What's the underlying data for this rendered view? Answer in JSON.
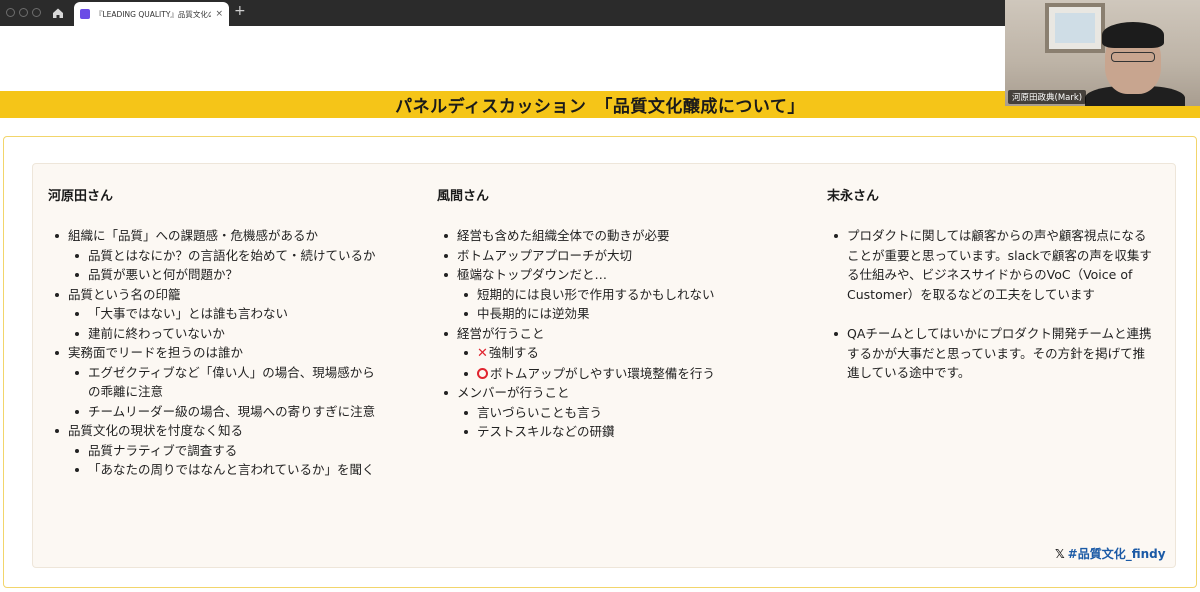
{
  "browser": {
    "tab_title": "『LEADING QUALITY』品質文化の醸",
    "tab_close": "×",
    "new_tab": "+"
  },
  "slide": {
    "title": "パネルディスカッション　「品質文化醸成について」",
    "hashtag": "#品質文化_findy",
    "columns": [
      {
        "name": "河原田さん",
        "items": [
          {
            "text": "組織に「品質」への課題感・危機感があるか",
            "sub": [
              "品質とはなにか？の言語化を始めて・続けているか",
              "品質が悪いと何が問題か？"
            ]
          },
          {
            "text": "品質という名の印籠",
            "sub": [
              "「大事ではない」とは誰も言わない",
              "建前に終わっていないか"
            ]
          },
          {
            "text": "実務面でリードを担うのは誰か",
            "sub": [
              "エグゼクティブなど「偉い人」の場合、現場感からの乖離に注意",
              "チームリーダー級の場合、現場への寄りすぎに注意"
            ]
          },
          {
            "text": "品質文化の現状を忖度なく知る",
            "sub": [
              "品質ナラティブで調査する",
              "「あなたの周りではなんと言われているか」を聞く"
            ]
          }
        ]
      },
      {
        "name": "風間さん",
        "items": [
          {
            "text": "経営も含めた組織全体での動きが必要",
            "sub": []
          },
          {
            "text": "ボトムアップアプローチが大切",
            "sub": []
          },
          {
            "text": "極端なトップダウンだと…",
            "sub": [
              "短期的には良い形で作用するかもしれない",
              "中長期的には逆効果"
            ]
          },
          {
            "text": "経営が行うこと",
            "sub": [
              "強制する",
              "ボトムアップがしやすい環境整備を行う"
            ]
          },
          {
            "text": "メンバーが行うこと",
            "sub": [
              "言いづらいことも言う",
              "テストスキルなどの研鑽"
            ]
          }
        ]
      },
      {
        "name": "末永さん",
        "items": [
          {
            "text": "プロダクトに関しては顧客からの声や顧客視点になることが重要と思っています。slackで顧客の声を収集する仕組みや、ビジネスサイドからのVoC（Voice of Customer）を取るなどの工夫をしています",
            "sub": []
          },
          {
            "text": "QAチームとしてはいかにプロダクト開発チームと連携するかが大事だと思っています。その方針を掲げて推進している途中です。",
            "sub": []
          }
        ]
      }
    ]
  },
  "webcam": {
    "participant_name": "河原田政典(Mark)"
  }
}
